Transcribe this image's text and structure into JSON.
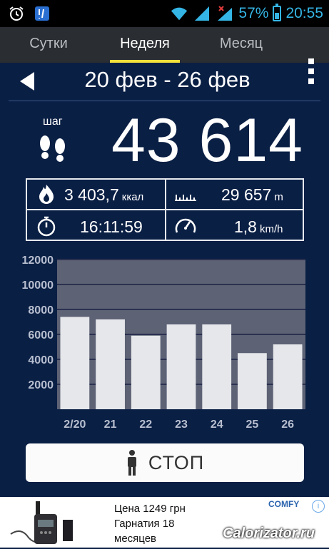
{
  "status_bar": {
    "battery": "57%",
    "time": "20:55",
    "battery_level": 0.57
  },
  "tabs": [
    {
      "label": "Сутки",
      "active": false
    },
    {
      "label": "Неделя",
      "active": true
    },
    {
      "label": "Месяц",
      "active": false
    }
  ],
  "date_range": "20 фев - 26 фев",
  "steps": {
    "unit": "шаг",
    "value": "43 614"
  },
  "stats": {
    "calories": {
      "value": "3 403,7",
      "unit": "ккал"
    },
    "distance": {
      "value": "29 657",
      "unit": "m"
    },
    "duration": {
      "value": "16:11:59"
    },
    "speed": {
      "value": "1,8",
      "unit": "km/h"
    }
  },
  "chart_data": {
    "type": "bar",
    "categories": [
      "2/20",
      "21",
      "22",
      "23",
      "24",
      "25",
      "26"
    ],
    "values": [
      7400,
      7200,
      5900,
      6800,
      6800,
      4500,
      5200
    ],
    "y_ticks": [
      "2000",
      "4000",
      "6000",
      "8000",
      "10000",
      "12000"
    ],
    "ylim": [
      0,
      12000
    ],
    "grid": true,
    "colors": {
      "bar": "#e5e7ea",
      "plot_bg": "#5d6275",
      "grid": "#2a3150"
    }
  },
  "stop_button": {
    "label": "СТОП"
  },
  "ad": {
    "line1": "Цена 1249 грн",
    "line2": "Гарнатия 18",
    "line3": "месяцев",
    "brand": "COMFY",
    "info": "i"
  },
  "watermark": "Calorizator.ru",
  "colors": {
    "accent": "#f3e03a",
    "background": "#0a1f44",
    "status_icons": "#34b5e5"
  }
}
